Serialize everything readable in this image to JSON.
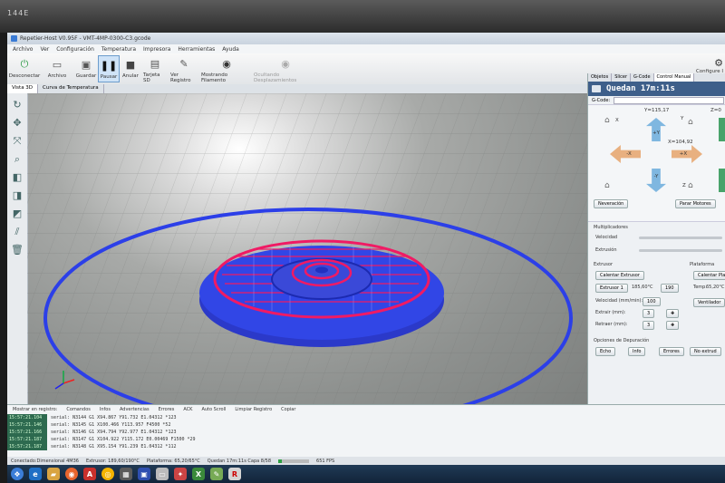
{
  "bezel": {
    "brand_text": "144E"
  },
  "window": {
    "title": "Repetier-Host V0.95F - VMT-4MP-0300-C3.gcode"
  },
  "menu": [
    "Archivo",
    "Ver",
    "Configuración",
    "Temperatura",
    "Impresora",
    "Herramientas",
    "Ayuda"
  ],
  "toolbar": {
    "buttons": [
      {
        "label": "Desconectar",
        "icon": "power-icon"
      },
      {
        "label": "Archivo",
        "icon": "file-icon"
      },
      {
        "label": "Guardar",
        "icon": "save-icon"
      },
      {
        "label": "Pausar",
        "icon": "pause-icon"
      },
      {
        "label": "Anular",
        "icon": "stop-icon"
      },
      {
        "label": "Tarjeta SD",
        "icon": "sd-card-icon"
      },
      {
        "label": "Ver Registro",
        "icon": "pencil-icon"
      },
      {
        "label": "Mostrando Filamento",
        "icon": "eye-icon"
      },
      {
        "label": "Ocultando Desplazamientos",
        "icon": "eye-icon"
      }
    ],
    "right_label": "Configure I"
  },
  "view_tabs": [
    "Vista 3D",
    "Curva de Temperatura"
  ],
  "right_panel": {
    "tabs": [
      "Objetos",
      "Slicer",
      "G-Code",
      "Control Manual"
    ],
    "status": "Quedan 17m:11s",
    "gcode_label": "G-Code:",
    "jog": {
      "y_readout": "Y=115,17",
      "z_readout": "Z=0",
      "x_readout": "X=104,92",
      "plus_y": "+Y",
      "minus_y": "-Y",
      "minus_x": "-X",
      "plus_x": "+X",
      "home_x": "X",
      "home_y": "Y",
      "home_z": "Z"
    },
    "neveracion_label": "Neveración",
    "parar_motores_label": "Parar Motores",
    "multiplicadores": "Multiplicadores",
    "velocidad": "Velocidad",
    "extrusion": "Extrusión",
    "extrusor_heading": "Extrusor",
    "plataforma_heading": "Plataforma",
    "calentar_extrusor": "Calentar Extrusor",
    "calentar_plataforma": "Calentar Pla",
    "extrusor_select": "Extrusor 1",
    "extrusor_temp": "185,60°C",
    "extrusor_target": "190",
    "temp_label": "Temp.",
    "plataforma_temp": "65,20°C",
    "velocidad_mm": "Velocidad (mm/min):",
    "velocidad_mm_value": "100",
    "ventilador": "Ventilador",
    "extraer": "Extrair (mm):",
    "extraer_value": "3",
    "retraer": "Retraer (mm):",
    "retraer_value": "3",
    "depuracion": "Opciones de Depuración",
    "eco": "Echo",
    "info": "Info",
    "errores": "Errores",
    "no_extrude": "No extrud"
  },
  "log": {
    "toolbar": [
      "Mostrar en registro:",
      "Comandos",
      "Infos",
      "Advertencias",
      "Errores",
      "ACK",
      "Auto Scroll",
      "Limpiar Registro",
      "Copiar"
    ],
    "lines": [
      {
        "time": "15:57:21.104",
        "msg": "serial: N3144 G1 X94.867 Y91.732 E1.04312 *123"
      },
      {
        "time": "15:57:21.146",
        "msg": "serial: N3145 G1 X100.466 Y113.957 F4500 *52"
      },
      {
        "time": "15:57:21.166",
        "msg": "serial: N3146 G1 X94.794 Y92.977 E1.04312 *123"
      },
      {
        "time": "15:57:21.187",
        "msg": "serial: N3147 G1 X104.922 Y115.172 E0.00469 F1500 *29"
      },
      {
        "time": "15:57:21.187",
        "msg": "serial: N3148 G1 X95.154 Y91.239 E1.04312 *112"
      }
    ]
  },
  "statusline": {
    "connection": "Conectado:Dimensional 4M36",
    "extrusor": "Extrusor: 189,60/190°C",
    "plataforma": "Plataforma: 65,20/65°C",
    "quedan": "Quedan 17m:11s Capa 8/58",
    "progress_fraction": 0.12,
    "fps": "651 FPS"
  },
  "colors": {
    "accent": "#3e5f8a",
    "model_blue": "#2f3ff0",
    "model_magenta": "#f01a64",
    "jog_green": "#48a36a",
    "jog_blue": "#7fb7e0",
    "jog_orange": "#e8b080"
  }
}
